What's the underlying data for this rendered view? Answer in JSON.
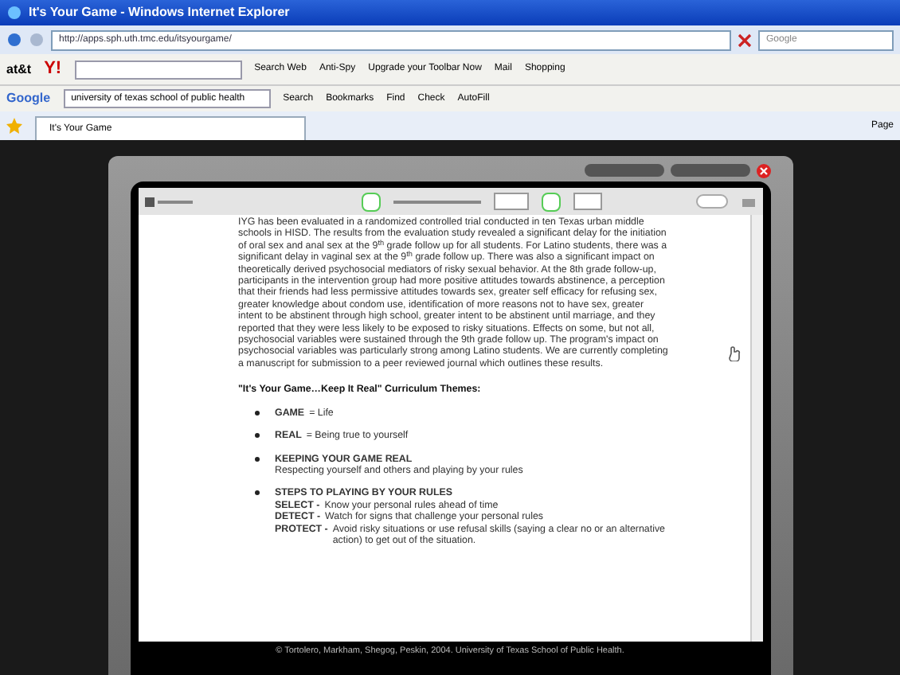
{
  "window": {
    "title": "It's Your Game - Windows Internet Explorer"
  },
  "address_bar": {
    "url": "http://apps.sph.uth.tmc.edu/itsyourgame/",
    "search_placeholder": "Google"
  },
  "toolbar": {
    "brand": "at&t",
    "logo": "Y!",
    "items": [
      {
        "label": "Search Web"
      },
      {
        "label": "Anti-Spy"
      },
      {
        "label": "Upgrade your Toolbar Now"
      },
      {
        "label": "Mail"
      },
      {
        "label": "Shopping"
      }
    ]
  },
  "google_toolbar": {
    "brand": "Google",
    "query": "university of texas school of public health",
    "items": [
      {
        "label": "Search"
      },
      {
        "label": "Bookmarks"
      },
      {
        "label": "Find"
      },
      {
        "label": "Check"
      },
      {
        "label": "AutoFill"
      }
    ]
  },
  "tabs": [
    {
      "label": "It's Your Game",
      "selected": true
    }
  ],
  "command_bar": {
    "page_label": "Page"
  },
  "document": {
    "paragraph": "IYG has been evaluated in a randomized controlled trial conducted in ten Texas urban middle schools in HISD. The results from the evaluation study revealed a significant delay for the initiation of oral sex and anal sex at the 9$^{th}$ grade follow up for all students. For Latino students, there was a significant delay in vaginal sex at the 9$^{th}$ grade follow up. There was also a significant impact on theoretically derived psychosocial mediators of risky sexual behavior. At the 8th grade follow-up, participants in the intervention group had more positive attitudes towards abstinence, a perception that their friends had less permissive attitudes towards sex, greater self efficacy for refusing sex, greater knowledge about condom use, identification of more reasons not to have sex, greater intent to be abstinent through high school, greater intent to be abstinent until marriage, and they reported that they were less likely to be exposed to risky situations. Effects on some, but not all, psychosocial variables were sustained through the 9th grade follow up. The program's impact on psychosocial variables was particularly strong among Latino students. We are currently completing a manuscript for submission to a peer reviewed journal which outlines these results.",
    "heading": "\"It's Your Game…Keep It Real\" Curriculum Themes:",
    "bullets": [
      {
        "kind": "inline",
        "title": "GAME",
        "text": "= Life"
      },
      {
        "kind": "inline",
        "title": "REAL",
        "text": "= Being true to yourself"
      },
      {
        "kind": "block",
        "title": "KEEPING YOUR GAME REAL",
        "text": "Respecting yourself and others and playing by your rules"
      },
      {
        "kind": "steps",
        "title": "STEPS TO PLAYING BY YOUR RULES",
        "steps": [
          {
            "term": "SELECT -",
            "text": "Know your personal rules ahead of time"
          },
          {
            "term": "DETECT -",
            "text": "Watch for signs that challenge your personal rules"
          },
          {
            "term": "PROTECT -",
            "text": "Avoid risky situations or use refusal skills (saying a clear no or an alternative action) to get out of the situation."
          }
        ]
      }
    ]
  },
  "footer": "© Tortolero, Markham, Shegog, Peskin, 2004. University of Texas School of Public Health."
}
